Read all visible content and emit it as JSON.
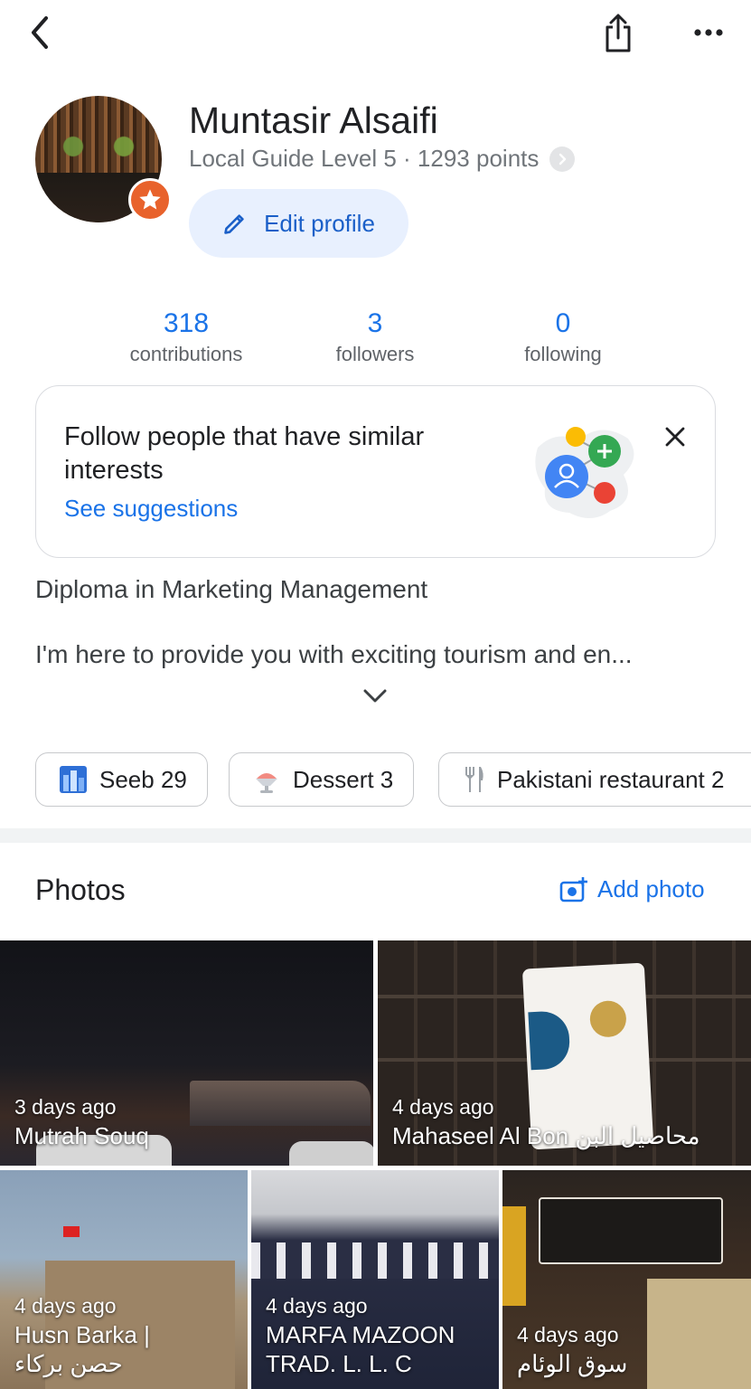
{
  "profile": {
    "name": "Muntasir Alsaifi",
    "level": "Local Guide Level 5 · 1293 points",
    "edit_label": "Edit profile"
  },
  "stats": [
    {
      "value": "318",
      "label": "contributions"
    },
    {
      "value": "3",
      "label": "followers"
    },
    {
      "value": "0",
      "label": "following"
    }
  ],
  "suggestion_card": {
    "text": "Follow people that have similar interests",
    "link": "See suggestions"
  },
  "bio": {
    "line1": "Diploma in Marketing Management",
    "line2": "I'm here to provide you with exciting tourism and en..."
  },
  "chips": [
    {
      "icon": "city-icon",
      "label": "Seeb 29"
    },
    {
      "icon": "dessert-icon",
      "label": "Dessert 3"
    },
    {
      "icon": "fork-knife-icon",
      "label": "Pakistani restaurant 2"
    }
  ],
  "photos": {
    "title": "Photos",
    "add_label": "Add photo",
    "items": [
      {
        "time": "3 days ago",
        "place": "Mutrah Souq"
      },
      {
        "time": "4 days ago",
        "place": "Mahaseel Al Bon محاصيل البن"
      },
      {
        "time": "4 days ago",
        "place": "Husn Barka |",
        "place2": "حصن بركاء"
      },
      {
        "time": "4 days ago",
        "place": "MARFA MAZOON",
        "place2": "TRAD. L. L. C"
      },
      {
        "time": "4 days ago",
        "place": "سوق الوئام"
      }
    ]
  },
  "colors": {
    "accent": "#1a73e8",
    "badge": "#e8622c",
    "edit_bg": "#e8f0fe"
  }
}
